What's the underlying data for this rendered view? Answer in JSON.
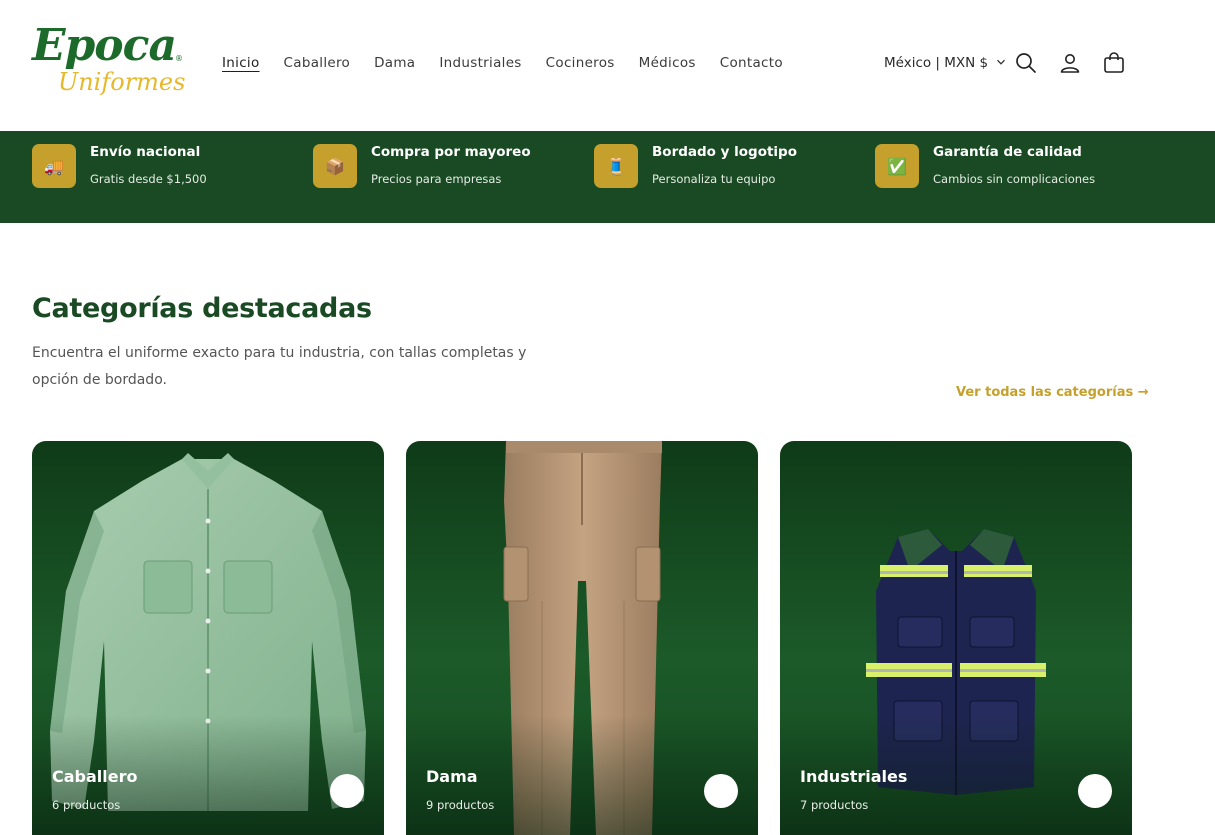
{
  "header": {
    "logo": {
      "line1": "Epoca",
      "line2": "Uniformes",
      "mark": "®"
    },
    "nav": [
      "Inicio",
      "Caballero",
      "Dama",
      "Industriales",
      "Cocineros",
      "Médicos",
      "Contacto"
    ],
    "active_nav": "Inicio",
    "currency": "México | MXN $",
    "icons": [
      "search-icon",
      "account-icon",
      "cart-icon"
    ]
  },
  "benefits": [
    {
      "icon": "🚚",
      "title": "Envío nacional",
      "subtitle": "Gratis desde $1,500"
    },
    {
      "icon": "📦",
      "title": "Compra por mayoreo",
      "subtitle": "Precios para empresas"
    },
    {
      "icon": "🧵",
      "title": "Bordado y logotipo",
      "subtitle": "Personaliza tu equipo"
    },
    {
      "icon": "✅",
      "title": "Garantía de calidad",
      "subtitle": "Cambios sin complicaciones"
    }
  ],
  "section": {
    "title": "Categorías destacadas",
    "description": "Encuentra el uniforme exacto para tu industria, con tallas completas y opción de bordado.",
    "see_all": "Ver todas las categorías →"
  },
  "categories": [
    {
      "name": "Caballero",
      "count": "6 productos"
    },
    {
      "name": "Dama",
      "count": "9 productos"
    },
    {
      "name": "Industriales",
      "count": "7 productos"
    }
  ],
  "colors": {
    "brand_green": "#1a4a23",
    "accent_gold": "#c5a02c",
    "logo_green": "#1c6b2a",
    "logo_yellow": "#e7b82c"
  }
}
